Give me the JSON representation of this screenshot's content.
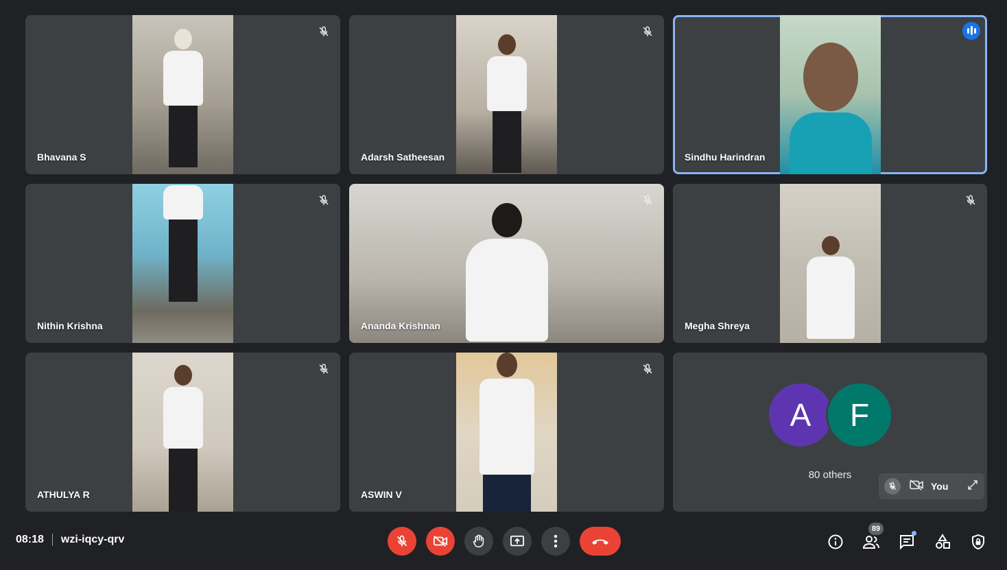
{
  "meeting": {
    "time": "08:18",
    "code": "wzi-iqcy-qrv"
  },
  "participants": [
    {
      "name": "Bhavana S",
      "muted": true,
      "speaking": false
    },
    {
      "name": "Adarsh Satheesan",
      "muted": true,
      "speaking": false
    },
    {
      "name": "Sindhu Harindran",
      "muted": false,
      "speaking": true
    },
    {
      "name": "Nithin Krishna",
      "muted": true,
      "speaking": false
    },
    {
      "name": "Ananda Krishnan",
      "muted": true,
      "speaking": false
    },
    {
      "name": "Megha Shreya",
      "muted": true,
      "speaking": false
    },
    {
      "name": "ATHULYA R",
      "muted": true,
      "speaking": false
    },
    {
      "name": "ASWIN V",
      "muted": true,
      "speaking": false
    }
  ],
  "others": {
    "avatars": [
      {
        "letter": "A",
        "color": "#5e35b1"
      },
      {
        "letter": "F",
        "color": "#00796b"
      }
    ],
    "label": "80 others"
  },
  "self": {
    "label": "You"
  },
  "toolbar": {
    "participant_count": "89"
  },
  "colors": {
    "background": "#202124",
    "tile": "#3c4043",
    "danger": "#ea4335",
    "active_outline": "#8ab4f8",
    "speaking": "#1a73e8"
  },
  "icons": {
    "mic_off": "mic-off-icon",
    "camera_off": "camera-off-icon",
    "raise_hand": "hand-icon",
    "present": "present-icon",
    "more": "more-vert-icon",
    "end_call": "phone-icon",
    "info": "info-icon",
    "people": "people-icon",
    "chat": "chat-icon",
    "activities": "activities-icon",
    "security": "shield-icon"
  }
}
